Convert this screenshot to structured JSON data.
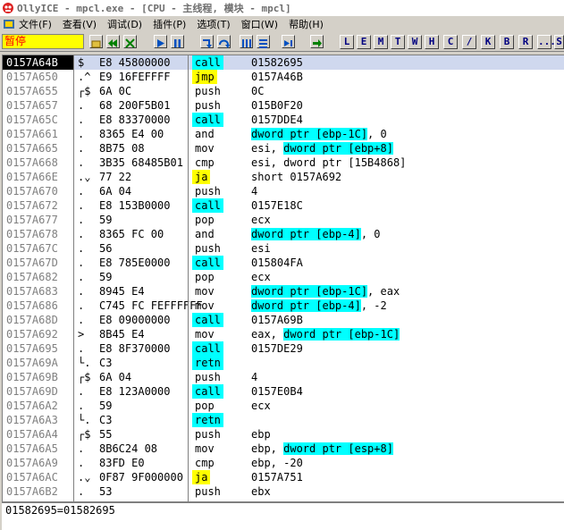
{
  "window": {
    "title": "OllyICE - mpcl.exe - [CPU - 主线程, 模块 - mpcl]"
  },
  "menu": {
    "items": [
      "文件(F)",
      "查看(V)",
      "调试(D)",
      "插件(P)",
      "选项(T)",
      "窗口(W)",
      "帮助(H)"
    ]
  },
  "toolbar": {
    "status": "暂停",
    "letter_buttons": [
      "L",
      "E",
      "M",
      "T",
      "W",
      "H",
      "C",
      "/",
      "K",
      "B",
      "R",
      "...",
      "S"
    ]
  },
  "disasm": {
    "rows": [
      {
        "addr": "0157A64B",
        "mark": "$",
        "hex": "E8 45800000",
        "mn": "call",
        "opd": [
          "01582695"
        ],
        "sel": true
      },
      {
        "addr": "0157A650",
        "mark": ".^",
        "hex": "E9 16FEFFFF",
        "mn": "jmp",
        "opd": [
          "0157A46B"
        ]
      },
      {
        "addr": "0157A655",
        "mark": "r$",
        "hex": "6A 0C",
        "mn": "push",
        "opd": [
          "0C"
        ]
      },
      {
        "addr": "0157A657",
        "mark": ".",
        "hex": "68 200F5B01",
        "mn": "push",
        "opd": [
          "015B0F20"
        ]
      },
      {
        "addr": "0157A65C",
        "mark": ".",
        "hex": "E8 83370000",
        "mn": "call",
        "opd": [
          "0157DDE4"
        ]
      },
      {
        "addr": "0157A661",
        "mark": ".",
        "hex": "8365 E4 00",
        "mn": "and",
        "opd": [
          "dword ptr [ebp-1C]",
          ", 0"
        ]
      },
      {
        "addr": "0157A665",
        "mark": ".",
        "hex": "8B75 08",
        "mn": "mov",
        "opd": [
          "esi, ",
          "dword ptr [ebp+8]"
        ]
      },
      {
        "addr": "0157A668",
        "mark": ".",
        "hex": "3B35 68485B01",
        "mn": "cmp",
        "opd": [
          "esi, dword ptr [15B4868]"
        ]
      },
      {
        "addr": "0157A66E",
        "mark": ".v",
        "hex": "77 22",
        "mn": "ja",
        "opd": [
          "short 0157A692"
        ]
      },
      {
        "addr": "0157A670",
        "mark": ".",
        "hex": "6A 04",
        "mn": "push",
        "opd": [
          "4"
        ]
      },
      {
        "addr": "0157A672",
        "mark": ".",
        "hex": "E8 153B0000",
        "mn": "call",
        "opd": [
          "0157E18C"
        ]
      },
      {
        "addr": "0157A677",
        "mark": ".",
        "hex": "59",
        "mn": "pop",
        "opd": [
          "ecx"
        ]
      },
      {
        "addr": "0157A678",
        "mark": ".",
        "hex": "8365 FC 00",
        "mn": "and",
        "opd": [
          "dword ptr [ebp-4]",
          ", 0"
        ]
      },
      {
        "addr": "0157A67C",
        "mark": ".",
        "hex": "56",
        "mn": "push",
        "opd": [
          "esi"
        ]
      },
      {
        "addr": "0157A67D",
        "mark": ".",
        "hex": "E8 785E0000",
        "mn": "call",
        "opd": [
          "015804FA"
        ]
      },
      {
        "addr": "0157A682",
        "mark": ".",
        "hex": "59",
        "mn": "pop",
        "opd": [
          "ecx"
        ]
      },
      {
        "addr": "0157A683",
        "mark": ".",
        "hex": "8945 E4",
        "mn": "mov",
        "opd": [
          "dword ptr [ebp-1C]",
          ", eax"
        ]
      },
      {
        "addr": "0157A686",
        "mark": ".",
        "hex": "C745 FC FEFFFFFF",
        "mn": "mov",
        "opd": [
          "dword ptr [ebp-4]",
          ", -2"
        ]
      },
      {
        "addr": "0157A68D",
        "mark": ".",
        "hex": "E8 09000000",
        "mn": "call",
        "opd": [
          "0157A69B"
        ]
      },
      {
        "addr": "0157A692",
        "mark": ">",
        "hex": "8B45 E4",
        "mn": "mov",
        "opd": [
          "eax, ",
          "dword ptr [ebp-1C]"
        ]
      },
      {
        "addr": "0157A695",
        "mark": ".",
        "hex": "E8 8F370000",
        "mn": "call",
        "opd": [
          "0157DE29"
        ]
      },
      {
        "addr": "0157A69A",
        "mark": "L.",
        "hex": "C3",
        "mn": "retn",
        "opd": [
          ""
        ]
      },
      {
        "addr": "0157A69B",
        "mark": "r$",
        "hex": "6A 04",
        "mn": "push",
        "opd": [
          "4"
        ]
      },
      {
        "addr": "0157A69D",
        "mark": ".",
        "hex": "E8 123A0000",
        "mn": "call",
        "opd": [
          "0157E0B4"
        ]
      },
      {
        "addr": "0157A6A2",
        "mark": ".",
        "hex": "59",
        "mn": "pop",
        "opd": [
          "ecx"
        ]
      },
      {
        "addr": "0157A6A3",
        "mark": "L.",
        "hex": "C3",
        "mn": "retn",
        "opd": [
          ""
        ]
      },
      {
        "addr": "0157A6A4",
        "mark": "r$",
        "hex": "55",
        "mn": "push",
        "opd": [
          "ebp"
        ]
      },
      {
        "addr": "0157A6A5",
        "mark": ".",
        "hex": "8B6C24 08",
        "mn": "mov",
        "opd": [
          "ebp, ",
          "dword ptr [esp+8]"
        ]
      },
      {
        "addr": "0157A6A9",
        "mark": ".",
        "hex": "83FD E0",
        "mn": "cmp",
        "opd": [
          "ebp, -20"
        ]
      },
      {
        "addr": "0157A6AC",
        "mark": ".v",
        "hex": "0F87 9F000000",
        "mn": "ja",
        "opd": [
          "0157A751"
        ]
      },
      {
        "addr": "0157A6B2",
        "mark": ".",
        "hex": "53",
        "mn": "push",
        "opd": [
          "ebx"
        ]
      }
    ]
  },
  "info": {
    "text": "01582695=01582695"
  }
}
